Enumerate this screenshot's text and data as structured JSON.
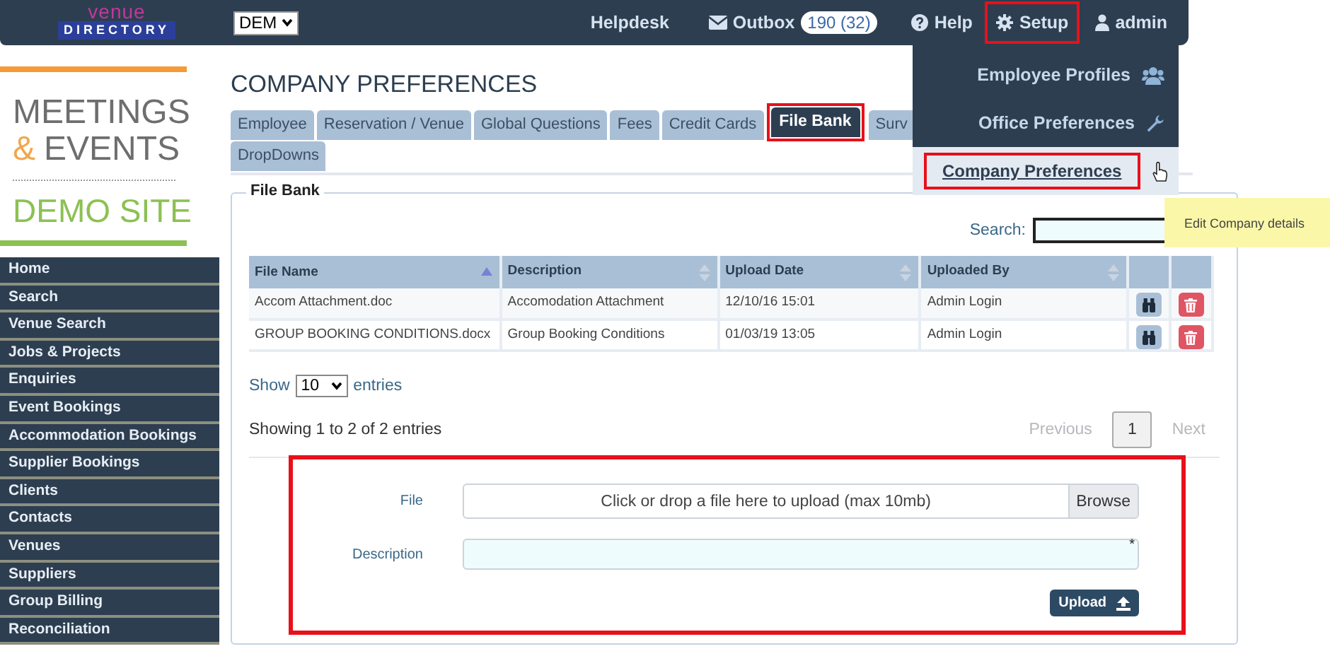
{
  "header": {
    "logo": {
      "line_1": "venue",
      "line_2": "DIRECTORY"
    },
    "site_select": {
      "value": "DEM"
    },
    "nav": [
      {
        "kind": "plain",
        "label": "Helpdesk",
        "highlighted": false
      },
      {
        "kind": "outbox",
        "label": "Outbox",
        "badge": "190 (32)",
        "highlighted": false
      },
      {
        "kind": "help",
        "label": "Help",
        "highlighted": false
      },
      {
        "kind": "setup",
        "label": "Setup",
        "highlighted": true
      },
      {
        "kind": "user",
        "label": "admin",
        "highlighted": false
      }
    ]
  },
  "setup_menu": {
    "items": [
      {
        "kind": "users",
        "label": "Employee Profiles",
        "selected": false,
        "highlighted": false
      },
      {
        "kind": "wrench",
        "label": "Office Preferences",
        "selected": false,
        "highlighted": false
      },
      {
        "kind": "none",
        "label": "Company Preferences",
        "selected": true,
        "highlighted": true
      }
    ]
  },
  "tooltip": "Edit Company details",
  "sidebar": {
    "brand": {
      "line_1": "MEETINGS",
      "line_2_mark": "&",
      "line_2": "EVENTS",
      "line_3": "DEMO SITE"
    },
    "items": [
      {
        "label": "Home"
      },
      {
        "label": "Search"
      },
      {
        "label": "Venue Search"
      },
      {
        "label": "Jobs & Projects"
      },
      {
        "label": "Enquiries"
      },
      {
        "label": "Event Bookings"
      },
      {
        "label": "Accommodation Bookings"
      },
      {
        "label": "Supplier Bookings"
      },
      {
        "label": "Clients"
      },
      {
        "label": "Contacts"
      },
      {
        "label": "Venues"
      },
      {
        "label": "Suppliers"
      },
      {
        "label": "Group Billing"
      },
      {
        "label": "Reconciliation"
      }
    ]
  },
  "page": {
    "title": "COMPANY PREFERENCES",
    "tabs": [
      {
        "label": "Employee",
        "selected": false,
        "highlighted": false
      },
      {
        "label": "Reservation / Venue",
        "selected": false,
        "highlighted": false
      },
      {
        "label": "Global Questions",
        "selected": false,
        "highlighted": false
      },
      {
        "label": "Fees",
        "selected": false,
        "highlighted": false
      },
      {
        "label": "Credit Cards",
        "selected": false,
        "highlighted": false
      },
      {
        "label": "File Bank",
        "selected": true,
        "highlighted": true
      },
      {
        "label": "Surv",
        "selected": false,
        "highlighted": false
      },
      {
        "label": "DropDowns",
        "selected": false,
        "highlighted": false
      }
    ]
  },
  "file_bank": {
    "legend": "File Bank",
    "search_label": "Search:",
    "table": {
      "columns": [
        {
          "label": "File Name",
          "sorted": true
        },
        {
          "label": "Description",
          "sorted": false
        },
        {
          "label": "Upload Date",
          "sorted": false
        },
        {
          "label": "Uploaded By",
          "sorted": false
        }
      ],
      "rows": [
        [
          "Accom Attachment.doc",
          "Accomodation Attachment",
          "12/10/16 15:01",
          "Admin Login"
        ],
        [
          "GROUP BOOKING CONDITIONS.docx",
          "Group Booking Conditions",
          "01/03/19 13:05",
          "Admin Login"
        ]
      ]
    },
    "length_menu": {
      "prefix": "Show",
      "value": "10",
      "suffix": "entries"
    },
    "info": "Showing 1 to 2 of 2 entries",
    "pagination": {
      "previous": {
        "label": "Previous",
        "disabled": true
      },
      "pages": [
        {
          "label": "1",
          "selected": true
        }
      ],
      "next": {
        "label": "Next",
        "disabled": true
      }
    }
  },
  "upload_form": {
    "highlighted": true,
    "file_label": "File",
    "file_placeholder": "Click or drop a file here to upload (max 10mb)",
    "browse": "Browse",
    "description_label": "Description",
    "required_mark": "*",
    "upload_button": "Upload"
  }
}
